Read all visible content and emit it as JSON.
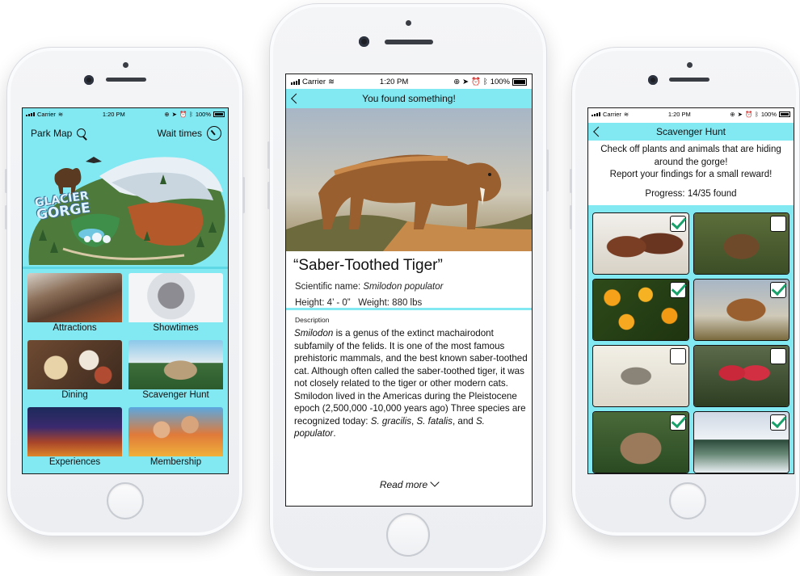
{
  "status": {
    "carrier": "Carrier",
    "time": "1:20 PM",
    "battery": "100%"
  },
  "home": {
    "park_map_label": "Park Map",
    "wait_times_label": "Wait times",
    "logo_line1": "GLACIER",
    "logo_line2": "GORGE",
    "tiles": [
      {
        "label": "Attractions",
        "icon": "attractions-photo"
      },
      {
        "label": "Showtimes",
        "icon": "mascot-photo"
      },
      {
        "label": "Dining",
        "icon": "food-photo"
      },
      {
        "label": "Scavenger Hunt",
        "icon": "statue-photo"
      },
      {
        "label": "Experiences",
        "icon": "exhibit-photo"
      },
      {
        "label": "Membership",
        "icon": "family-photo"
      }
    ]
  },
  "detail": {
    "nav_title": "You found something!",
    "name": "“Saber-Toothed Tiger”",
    "sci_prefix": "Scientific name:",
    "sci_name": "Smilodon populator",
    "height_label": "Height: 4’ - 0”",
    "weight_label": "Weight: 880 lbs",
    "description_label": "Description",
    "desc_em1": "Smilodon",
    "desc_text1": " is a genus of the extinct machairodont subfamily of the felids. It is one of the most famous prehistoric mammals, and the best known saber-toothed cat. Although often called the saber-toothed tiger, it was not closely related to the tiger or other modern cats. Smilodon lived in the Americas during the Pleistocene epoch (2,500,000 -10,000 years ago) Three species are recognized today: ",
    "desc_em2": "S. gracilis",
    "desc_sep1": ", ",
    "desc_em3": "S. fatalis",
    "desc_sep2": ", and ",
    "desc_em4": "S. populator",
    "desc_end": ".",
    "read_more": "Read more"
  },
  "hunt": {
    "nav_title": "Scavenger Hunt",
    "intro_line1": "Check off plants and animals that are hiding",
    "intro_line2": "around the gorge!",
    "intro_line3": "Report your findings for a small reward!",
    "progress": "Progress: 14/35 found",
    "items": [
      {
        "icon": "mammoths-photo",
        "checked": true
      },
      {
        "icon": "bear-photo",
        "checked": false
      },
      {
        "icon": "poppies-photo",
        "checked": true
      },
      {
        "icon": "sabertooth-photo",
        "checked": true
      },
      {
        "icon": "dodo-photo",
        "checked": false
      },
      {
        "icon": "red-flower-photo",
        "checked": false
      },
      {
        "icon": "glyptodon-photo",
        "checked": true
      },
      {
        "icon": "snowy-forest-photo",
        "checked": true
      }
    ]
  },
  "colors": {
    "accent": "#82e8f2",
    "check": "#1aa06a"
  }
}
